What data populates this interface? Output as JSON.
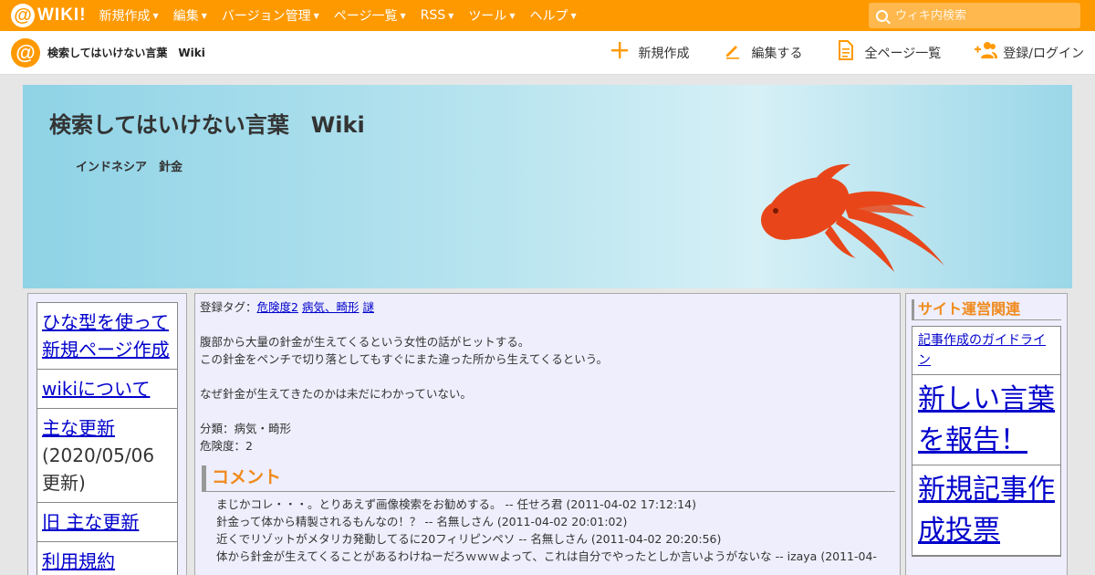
{
  "topbar": {
    "brand_at": "@",
    "brand_text": "WIKI!",
    "menu": [
      {
        "label": "新規作成"
      },
      {
        "label": "編集"
      },
      {
        "label": "バージョン管理"
      },
      {
        "label": "ページ一覧"
      },
      {
        "label": "RSS"
      },
      {
        "label": "ツール"
      },
      {
        "label": "ヘルプ"
      }
    ],
    "search_placeholder": "ウィキ内検索"
  },
  "subbar": {
    "logo": "@",
    "site_name": "検索してはいけない言葉　Wiki",
    "actions": [
      {
        "label": "新規作成",
        "icon": "plus-icon"
      },
      {
        "label": "編集する",
        "icon": "pencil-icon"
      },
      {
        "label": "全ページ一覧",
        "icon": "document-icon"
      },
      {
        "label": "登録/ログイン",
        "icon": "add-user-icon"
      }
    ]
  },
  "banner": {
    "title": "検索してはいけない言葉　Wiki",
    "subtitle": "インドネシア　針金"
  },
  "left_nav": [
    {
      "label": "ひな型を使って新規ページ作成",
      "suffix": ""
    },
    {
      "label": "wikiについて",
      "suffix": ""
    },
    {
      "label": "主な更新",
      "suffix": "(2020/05/06更新)"
    },
    {
      "label": "旧 主な更新",
      "suffix": ""
    },
    {
      "label": "利用規約",
      "suffix": ""
    }
  ],
  "main": {
    "tags_label": "登録タグ：",
    "tags": [
      "危険度2",
      "病気、畸形",
      "謎"
    ],
    "body_lines": [
      "腹部から大量の針金が生えてくるという女性の話がヒットする。",
      "この針金をペンチで切り落としてもすぐにまた違った所から生えてくるという。"
    ],
    "line3": "なぜ針金が生えてきたのかは未だにわかっていない。",
    "category": "分類：病気・畸形",
    "danger": "危険度：2",
    "comment_heading": "コメント",
    "comments": [
      "まじかコレ・・・。とりあえず画像検索をお勧めする。 -- 任せろ君 (2011-04-02 17:12:14)",
      "針金って体から精製されるもんなの！？ -- 名無しさん (2011-04-02 20:01:02)",
      "近くでリゾットがメタリカ発動してるに20フィリピンペソ -- 名無しさん (2011-04-02 20:20:56)",
      "体から針金が生えてくることがあるわけねーだろｗｗｗよって、これは自分でやったとしか言いようがないな -- izaya (2011-04-"
    ]
  },
  "right": {
    "heading": "サイト運営関連",
    "items": [
      {
        "label": "記事作成のガイドライン",
        "size": "small"
      },
      {
        "label": "新しい言葉を報告！",
        "size": "big"
      },
      {
        "label": "新規記事作成投票",
        "size": "big"
      }
    ]
  },
  "colors": {
    "brand_orange": "#ff9900",
    "heading_orange": "#f08a1c",
    "link_blue": "#0000cc",
    "panel_bg": "#eeeefc",
    "fish_red": "#e8461a"
  }
}
